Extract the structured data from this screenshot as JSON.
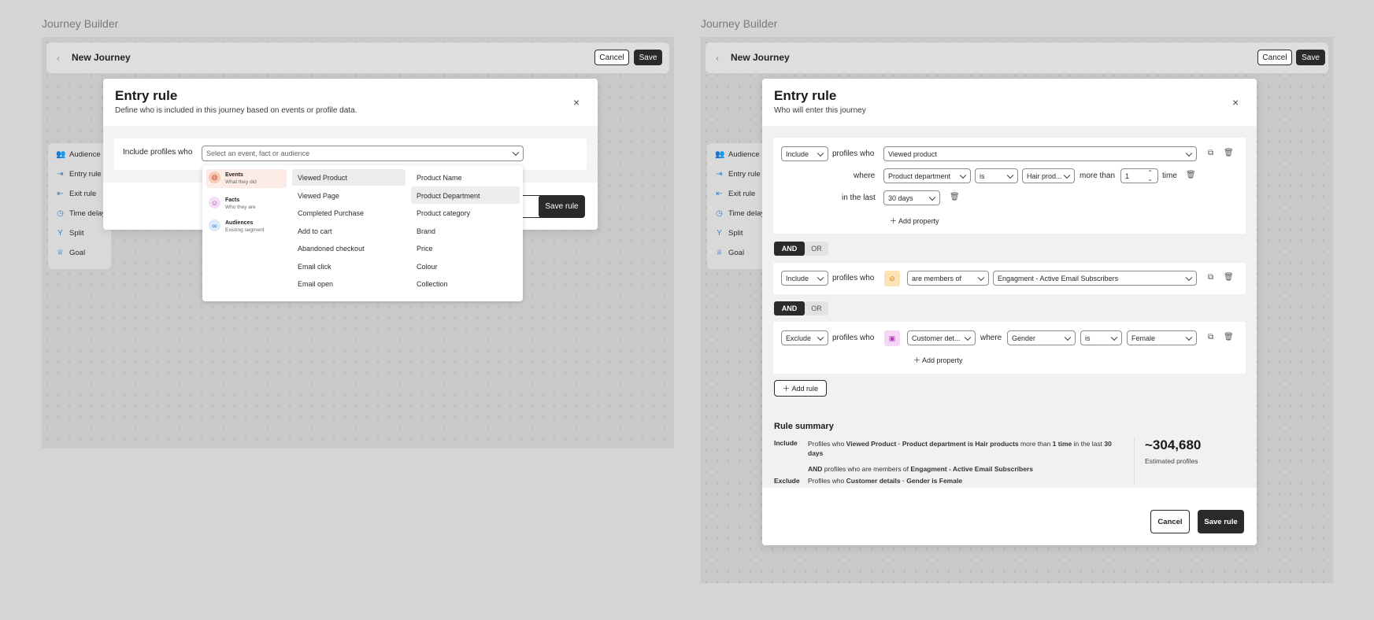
{
  "left": {
    "frame_label": "Journey Builder",
    "topbar": {
      "back": "‹",
      "title": "New Journey",
      "cancel": "Cancel",
      "save": "Save"
    },
    "sidebar": [
      "Audience",
      "Entry rule",
      "Exit rule",
      "Time delay",
      "Split",
      "Goal"
    ],
    "modal": {
      "title": "Entry rule",
      "subtitle": "Define who is included in this journey based on events or profile data.",
      "close": "×",
      "include_label": "Include profiles who",
      "select_placeholder": "Select an event, fact or audience",
      "save_rule": "Save rule"
    },
    "dropdown": {
      "categories": [
        {
          "label": "Events",
          "desc": "What they did",
          "icon": "mouse-icon"
        },
        {
          "label": "Facts",
          "desc": "Who they are",
          "icon": "person-icon"
        },
        {
          "label": "Audiences",
          "desc": "Existing segment",
          "icon": "link-icon"
        }
      ],
      "events": [
        "Viewed Product",
        "Viewed Page",
        "Completed Purchase",
        "Add to cart",
        "Abandoned checkout",
        "Email click",
        "Email open"
      ],
      "properties": [
        "Product Name",
        "Product Department",
        "Product category",
        "Brand",
        "Price",
        "Colour",
        "Collection"
      ]
    }
  },
  "right": {
    "frame_label": "Journey Builder",
    "topbar": {
      "back": "‹",
      "title": "New Journey",
      "cancel": "Cancel",
      "save": "Save"
    },
    "sidebar": [
      "Audience",
      "Entry rule",
      "Exit rule",
      "Time delay",
      "Split",
      "Goal"
    ],
    "modal": {
      "title": "Entry rule",
      "subtitle": "Who will enter this journey",
      "close": "×",
      "rule1": {
        "mode": "Include",
        "profiles_who": "profiles who",
        "event": "Viewed product",
        "where": "where",
        "property": "Product department",
        "operator": "is",
        "value": "Hair prod...",
        "more_than": "more than",
        "count": "1",
        "time": "time",
        "in_the_last": "in the last",
        "period": "30 days",
        "add_property": "Add property"
      },
      "join1": {
        "and": "AND",
        "or": "OR"
      },
      "rule2": {
        "mode": "Include",
        "profiles_who": "profiles who",
        "relation": "are members of",
        "audience": "Engagment - Active Email Subscribers"
      },
      "join2": {
        "and": "AND",
        "or": "OR"
      },
      "rule3": {
        "mode": "Exclude",
        "profiles_who": "profiles who",
        "fact": "Customer det...",
        "where": "where",
        "property": "Gender",
        "operator": "is",
        "value": "Female",
        "add_property": "Add property"
      },
      "add_rule": "Add rule",
      "summary": {
        "title": "Rule summary",
        "include_label": "Include",
        "include_pre": "Profiles who ",
        "include_b1": "Viewed Product · Product department is Hair products",
        "include_mid": " more than ",
        "include_b2": "1 time",
        "include_mid2": " in the last ",
        "include_b3": "30 days",
        "and_b": "AND",
        "and_text": " profiles who are members of ",
        "and_b2": "Engagment - Active Email Subscribers",
        "exclude_label": "Exclude",
        "exclude_pre": "Profiles who ",
        "exclude_b": "Customer details · Gender is Female",
        "count": "~304,680",
        "count_label": "Estimated profiles"
      },
      "cancel": "Cancel",
      "save_rule": "Save rule"
    }
  }
}
